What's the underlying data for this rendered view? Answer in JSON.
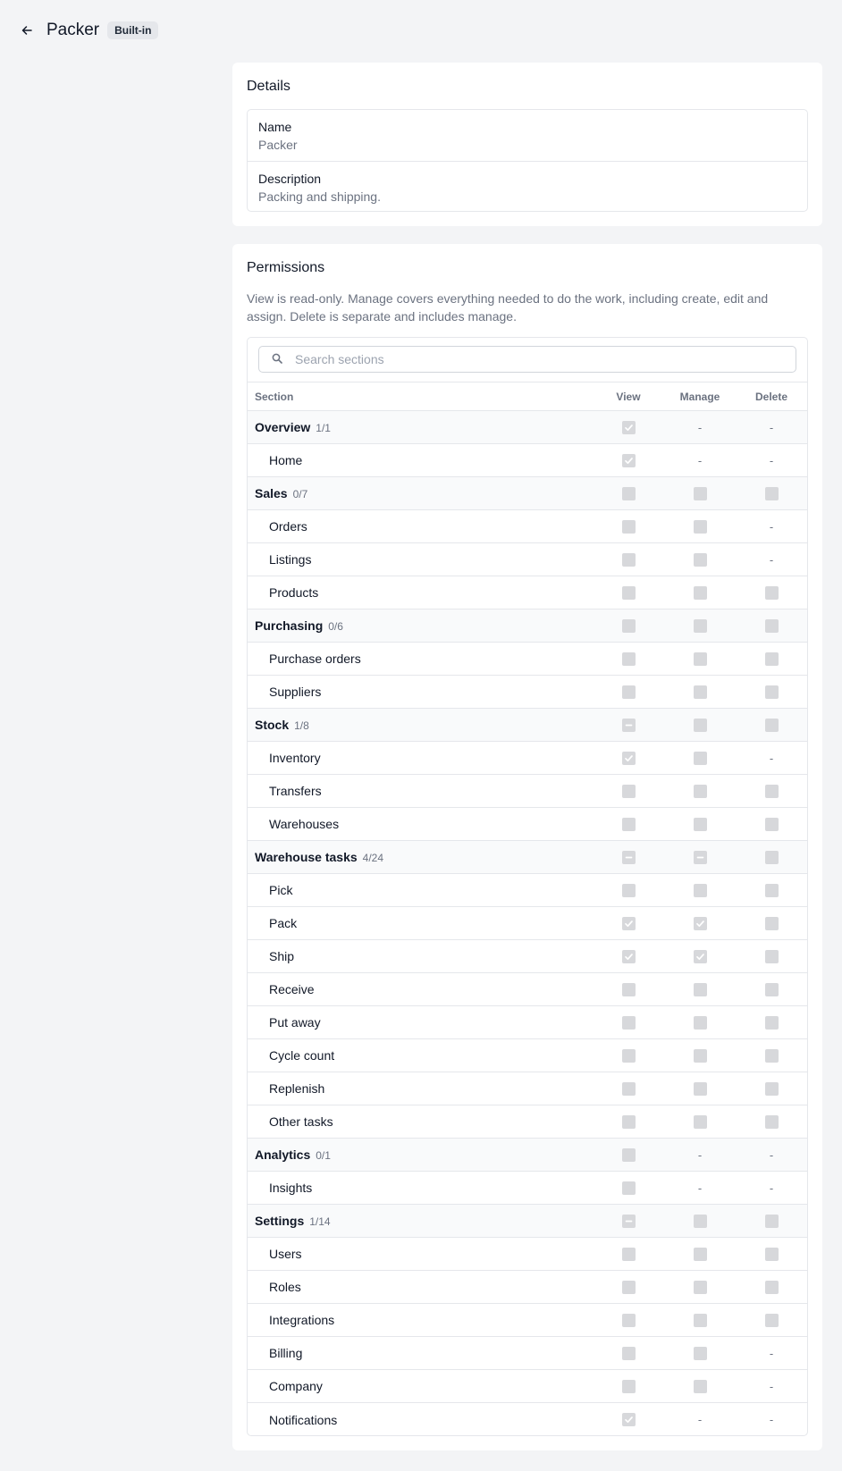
{
  "header": {
    "title": "Packer",
    "badge": "Built-in"
  },
  "details": {
    "title": "Details",
    "fields": [
      {
        "label": "Name",
        "value": "Packer"
      },
      {
        "label": "Description",
        "value": "Packing and shipping."
      }
    ]
  },
  "permissions": {
    "title": "Permissions",
    "description": "View is read-only. Manage covers everything needed to do the work, including create, edit and assign. Delete is separate and includes manage.",
    "search_placeholder": "Search sections",
    "columns": {
      "section": "Section",
      "view": "View",
      "manage": "Manage",
      "delete": "Delete"
    },
    "rows": [
      {
        "type": "group",
        "label": "Overview",
        "count": "1/1",
        "view": "checked",
        "manage": "na",
        "delete": "na"
      },
      {
        "type": "item",
        "label": "Home",
        "view": "checked",
        "manage": "na",
        "delete": "na"
      },
      {
        "type": "group",
        "label": "Sales",
        "count": "0/7",
        "view": "unchecked",
        "manage": "unchecked",
        "delete": "unchecked"
      },
      {
        "type": "item",
        "label": "Orders",
        "view": "unchecked",
        "manage": "unchecked",
        "delete": "na"
      },
      {
        "type": "item",
        "label": "Listings",
        "view": "unchecked",
        "manage": "unchecked",
        "delete": "na"
      },
      {
        "type": "item",
        "label": "Products",
        "view": "unchecked",
        "manage": "unchecked",
        "delete": "unchecked"
      },
      {
        "type": "group",
        "label": "Purchasing",
        "count": "0/6",
        "view": "unchecked",
        "manage": "unchecked",
        "delete": "unchecked"
      },
      {
        "type": "item",
        "label": "Purchase orders",
        "view": "unchecked",
        "manage": "unchecked",
        "delete": "unchecked"
      },
      {
        "type": "item",
        "label": "Suppliers",
        "view": "unchecked",
        "manage": "unchecked",
        "delete": "unchecked"
      },
      {
        "type": "group",
        "label": "Stock",
        "count": "1/8",
        "view": "indeterminate",
        "manage": "unchecked",
        "delete": "unchecked"
      },
      {
        "type": "item",
        "label": "Inventory",
        "view": "checked",
        "manage": "unchecked",
        "delete": "na"
      },
      {
        "type": "item",
        "label": "Transfers",
        "view": "unchecked",
        "manage": "unchecked",
        "delete": "unchecked"
      },
      {
        "type": "item",
        "label": "Warehouses",
        "view": "unchecked",
        "manage": "unchecked",
        "delete": "unchecked"
      },
      {
        "type": "group",
        "label": "Warehouse tasks",
        "count": "4/24",
        "view": "indeterminate",
        "manage": "indeterminate",
        "delete": "unchecked"
      },
      {
        "type": "item",
        "label": "Pick",
        "view": "unchecked",
        "manage": "unchecked",
        "delete": "unchecked"
      },
      {
        "type": "item",
        "label": "Pack",
        "view": "checked",
        "manage": "checked",
        "delete": "unchecked"
      },
      {
        "type": "item",
        "label": "Ship",
        "view": "checked",
        "manage": "checked",
        "delete": "unchecked"
      },
      {
        "type": "item",
        "label": "Receive",
        "view": "unchecked",
        "manage": "unchecked",
        "delete": "unchecked"
      },
      {
        "type": "item",
        "label": "Put away",
        "view": "unchecked",
        "manage": "unchecked",
        "delete": "unchecked"
      },
      {
        "type": "item",
        "label": "Cycle count",
        "view": "unchecked",
        "manage": "unchecked",
        "delete": "unchecked"
      },
      {
        "type": "item",
        "label": "Replenish",
        "view": "unchecked",
        "manage": "unchecked",
        "delete": "unchecked"
      },
      {
        "type": "item",
        "label": "Other tasks",
        "view": "unchecked",
        "manage": "unchecked",
        "delete": "unchecked"
      },
      {
        "type": "group",
        "label": "Analytics",
        "count": "0/1",
        "view": "unchecked",
        "manage": "na",
        "delete": "na"
      },
      {
        "type": "item",
        "label": "Insights",
        "view": "unchecked",
        "manage": "na",
        "delete": "na"
      },
      {
        "type": "group",
        "label": "Settings",
        "count": "1/14",
        "view": "indeterminate",
        "manage": "unchecked",
        "delete": "unchecked"
      },
      {
        "type": "item",
        "label": "Users",
        "view": "unchecked",
        "manage": "unchecked",
        "delete": "unchecked"
      },
      {
        "type": "item",
        "label": "Roles",
        "view": "unchecked",
        "manage": "unchecked",
        "delete": "unchecked"
      },
      {
        "type": "item",
        "label": "Integrations",
        "view": "unchecked",
        "manage": "unchecked",
        "delete": "unchecked"
      },
      {
        "type": "item",
        "label": "Billing",
        "view": "unchecked",
        "manage": "unchecked",
        "delete": "na"
      },
      {
        "type": "item",
        "label": "Company",
        "view": "unchecked",
        "manage": "unchecked",
        "delete": "na"
      },
      {
        "type": "item",
        "label": "Notifications",
        "view": "checked",
        "manage": "na",
        "delete": "na"
      }
    ],
    "na_symbol": "-"
  }
}
